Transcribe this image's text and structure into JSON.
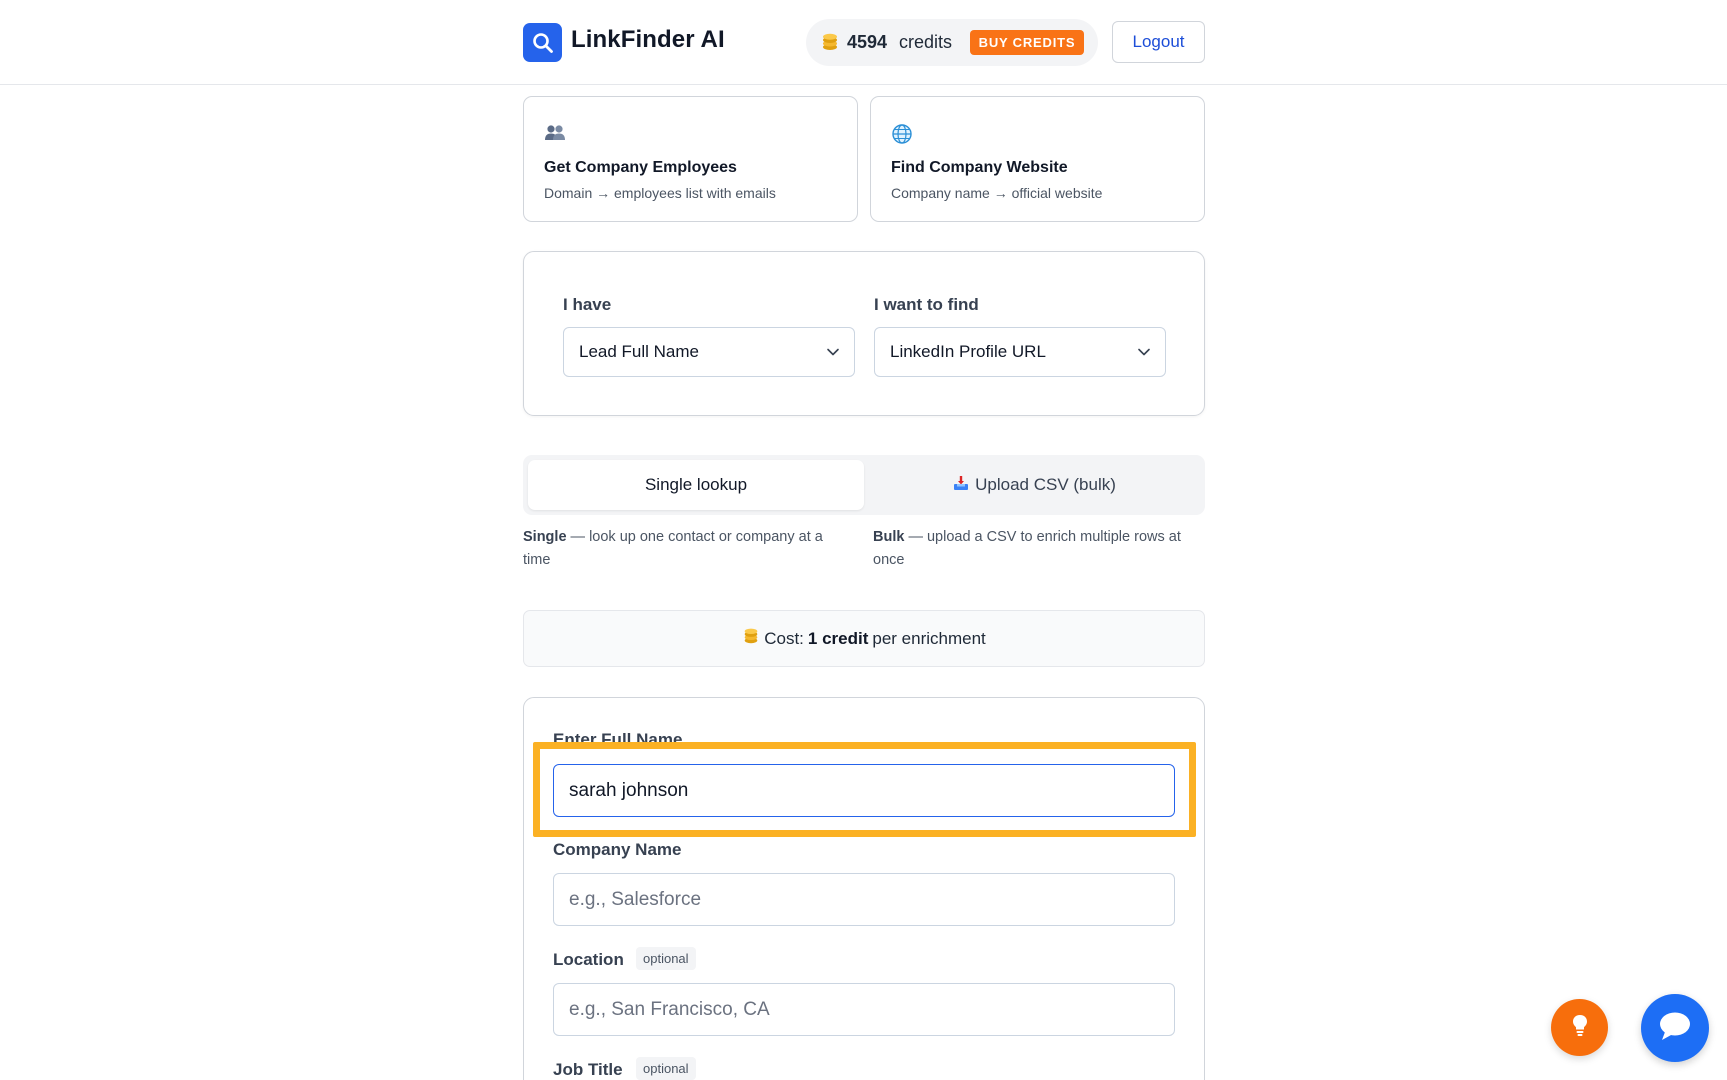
{
  "header": {
    "brand": "LinkFinder AI",
    "credits_count": "4594",
    "credits_label": "credits",
    "buy_label": "BUY CREDITS",
    "logout_label": "Logout",
    "accent": "#2563eb",
    "buy_color": "#f97316"
  },
  "tools": [
    {
      "icon": "people-icon",
      "title": "Get Company Employees",
      "desc": "Domain → employees list with emails"
    },
    {
      "icon": "globe-icon",
      "title": "Find Company Website",
      "desc": "Company name → official website"
    }
  ],
  "selector": {
    "have_label": "I have",
    "have_value": "Lead Full Name",
    "find_label": "I want to find",
    "find_value": "LinkedIn Profile URL"
  },
  "tabs": {
    "single": "Single lookup",
    "bulk": "Upload CSV (bulk)"
  },
  "mode_desc": {
    "single_title": "Single",
    "single_text": " — look up one contact or company at a time",
    "bulk_title": "Bulk",
    "bulk_text": " — upload a CSV to enrich multiple rows at once"
  },
  "cost": {
    "prefix": "Cost:",
    "amount": "1 credit",
    "suffix": "per enrichment"
  },
  "form": {
    "full_name_label": "Enter Full Name",
    "full_name_value": "sarah johnson",
    "company_label": "Company Name",
    "company_placeholder": "e.g., Salesforce",
    "location_label": "Location",
    "location_badge": "optional",
    "location_placeholder": "e.g., San Francisco, CA",
    "job_label": "Job Title",
    "job_badge": "optional"
  },
  "highlight_color": "#fbb124"
}
